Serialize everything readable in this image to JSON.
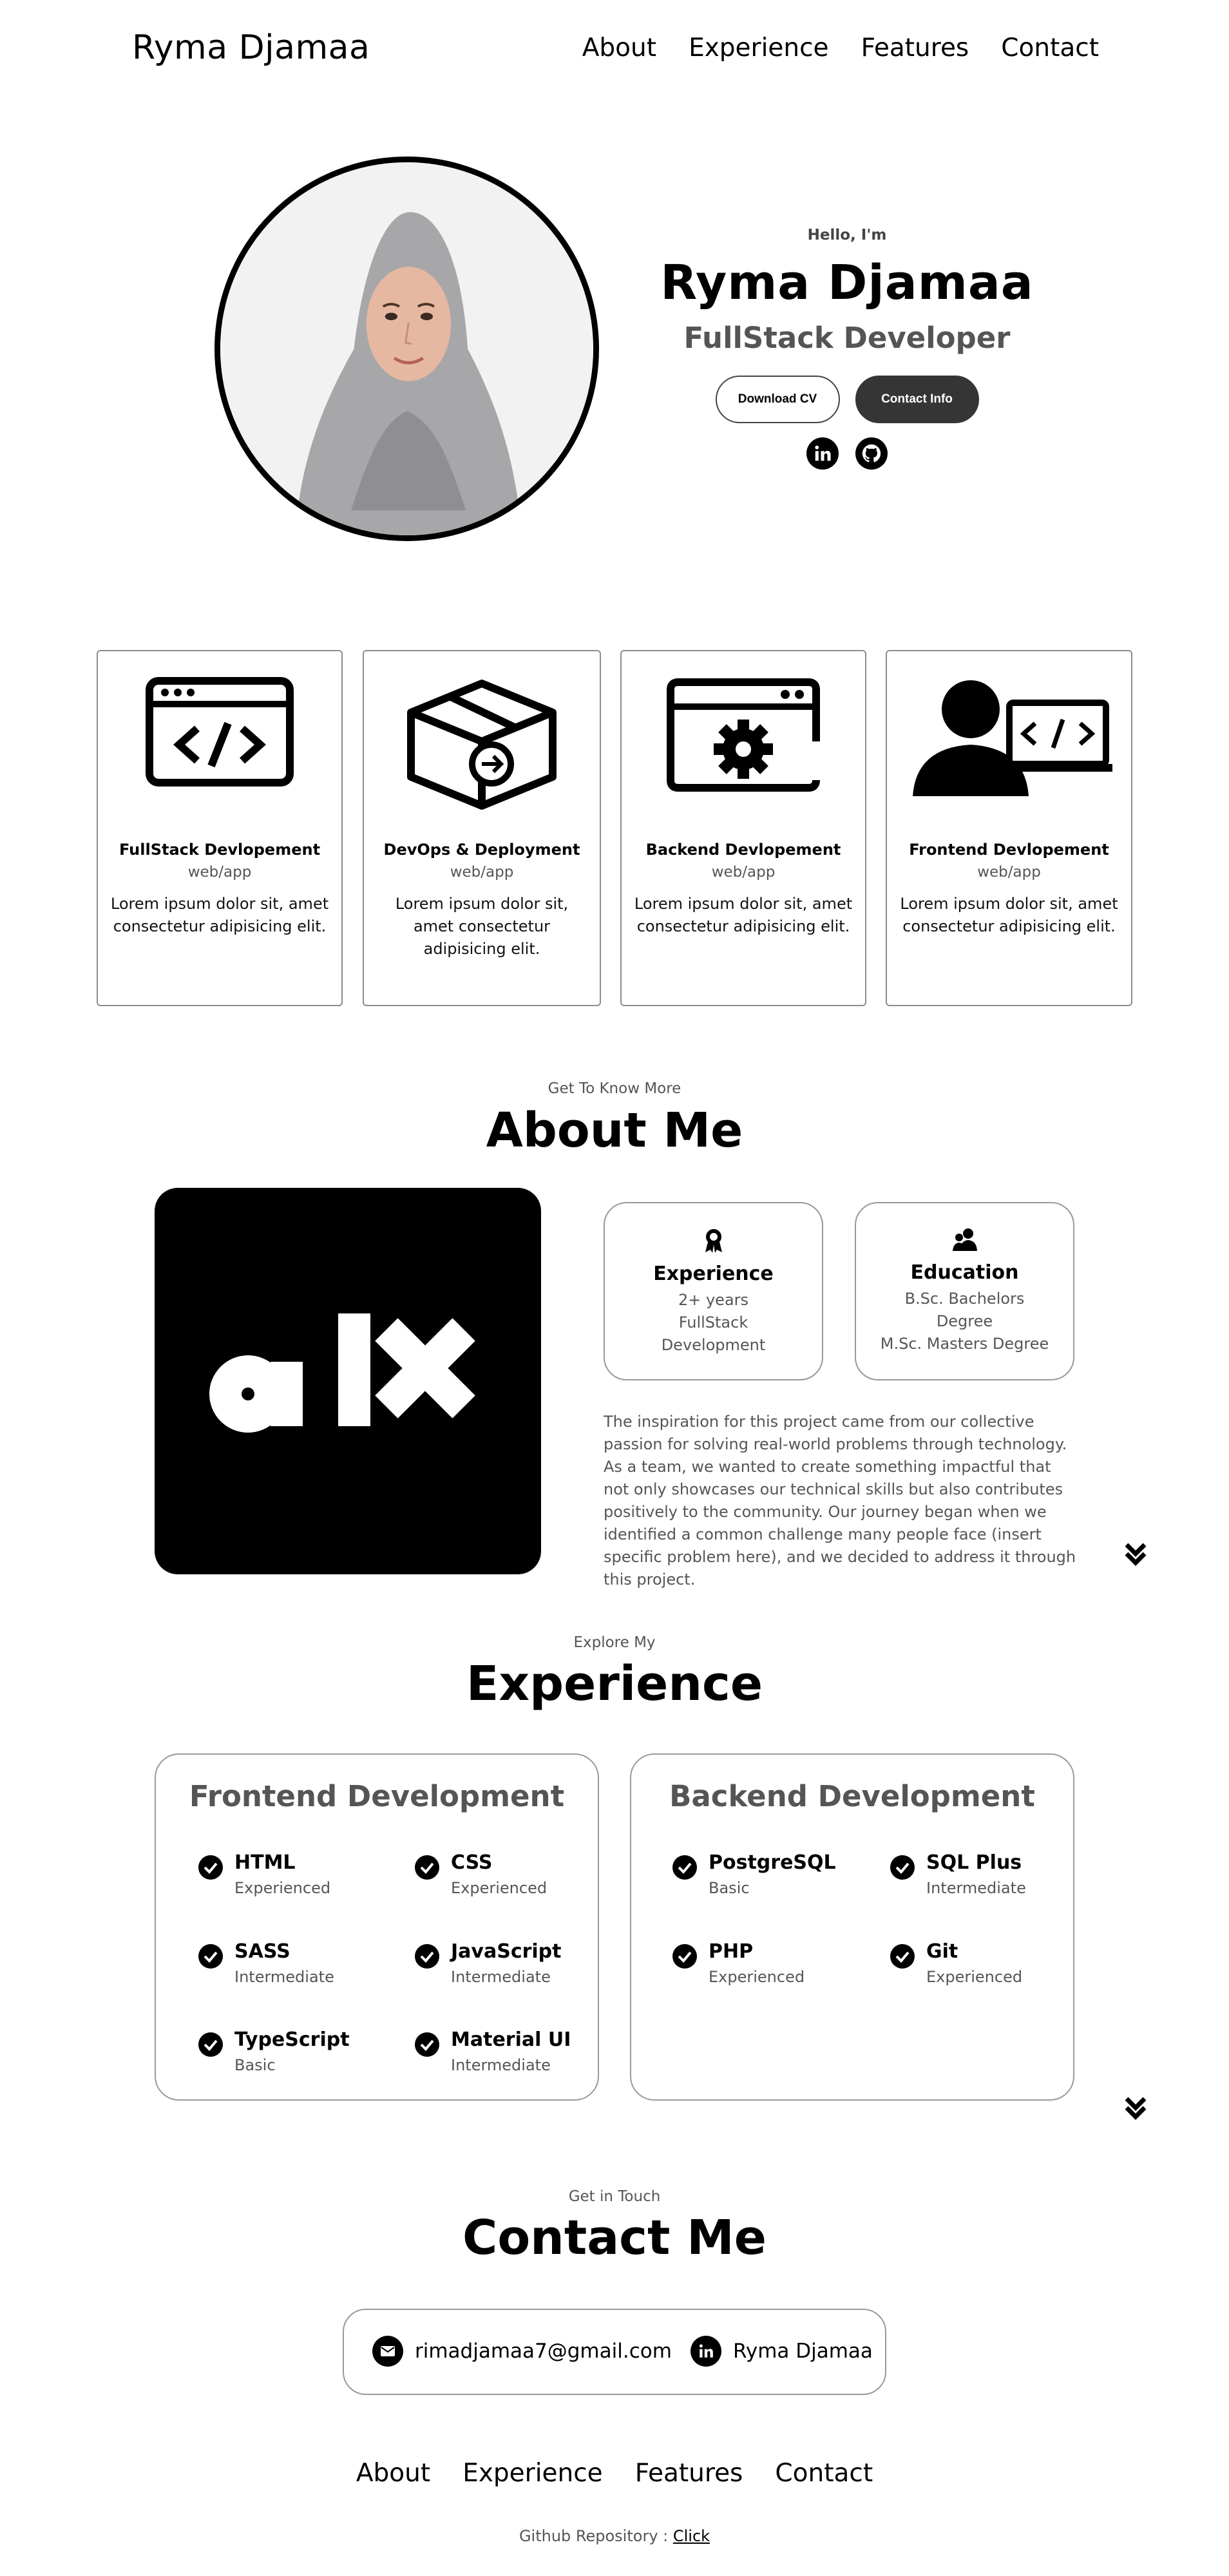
{
  "header": {
    "logo": "Ryma Djamaa",
    "nav": [
      "About",
      "Experience",
      "Features",
      "Contact"
    ]
  },
  "hero": {
    "greeting": "Hello, I'm",
    "name": "Ryma Djamaa",
    "role": "FullStack Developer",
    "download_cv": "Download CV",
    "contact_info": "Contact Info",
    "socials": [
      "linkedin-icon",
      "github-icon"
    ]
  },
  "features": [
    {
      "title": "FullStack Devlopement",
      "subtitle": "web/app",
      "desc": "Lorem ipsum dolor sit, amet consectetur adipisicing elit.",
      "icon": "code-window-icon"
    },
    {
      "title": "DevOps & Deployment",
      "subtitle": "web/app",
      "desc": "Lorem ipsum dolor sit, amet consectetur adipisicing elit.",
      "icon": "deploy-box-icon"
    },
    {
      "title": "Backend Devlopement",
      "subtitle": "web/app",
      "desc": "Lorem ipsum dolor sit, amet consectetur adipisicing elit.",
      "icon": "settings-window-icon"
    },
    {
      "title": "Frontend Devlopement",
      "subtitle": "web/app",
      "desc": "Lorem ipsum dolor sit, amet consectetur adipisicing elit.",
      "icon": "developer-screen-icon"
    }
  ],
  "about": {
    "kicker": "Get To Know More",
    "title": "About Me",
    "logo_text": "alx",
    "experience": {
      "title": "Experience",
      "lines": [
        "2+ years",
        "FullStack",
        "Development"
      ]
    },
    "education": {
      "title": "Education",
      "lines": [
        "B.Sc. Bachelors",
        "Degree",
        "M.Sc. Masters Degree"
      ]
    },
    "paragraph": "The inspiration for this project came from our collective passion for solving real-world problems through technology. As a team, we wanted to create something impactful that not only showcases our technical skills but also contributes positively to the community. Our journey began when we identified a common challenge many people face (insert specific problem here), and we decided to address it through this project."
  },
  "experience": {
    "kicker": "Explore My",
    "title": "Experience",
    "frontend": {
      "title": "Frontend Development",
      "skills": [
        {
          "name": "HTML",
          "level": "Experienced"
        },
        {
          "name": "CSS",
          "level": "Experienced"
        },
        {
          "name": "SASS",
          "level": "Intermediate"
        },
        {
          "name": "JavaScript",
          "level": "Intermediate"
        },
        {
          "name": "TypeScript",
          "level": "Basic"
        },
        {
          "name": "Material UI",
          "level": "Intermediate"
        }
      ]
    },
    "backend": {
      "title": "Backend Development",
      "skills": [
        {
          "name": "PostgreSQL",
          "level": "Basic"
        },
        {
          "name": "SQL Plus",
          "level": "Intermediate"
        },
        {
          "name": "PHP",
          "level": "Experienced"
        },
        {
          "name": "Git",
          "level": "Experienced"
        }
      ]
    }
  },
  "contact": {
    "kicker": "Get in Touch",
    "title": "Contact Me",
    "email": "rimadjamaa7@gmail.com",
    "linkedin": "Ryma Djamaa"
  },
  "footer": {
    "nav": [
      "About",
      "Experience",
      "Features",
      "Contact"
    ],
    "repo_label": "Github Repository : ",
    "repo_link": "Click"
  }
}
